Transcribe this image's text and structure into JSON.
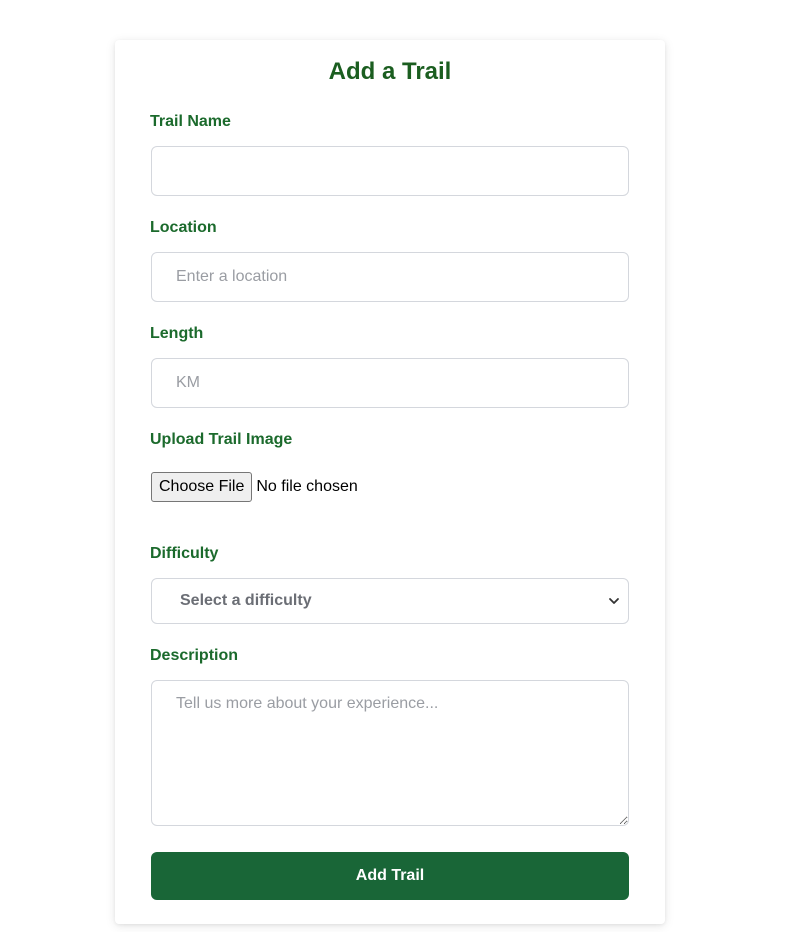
{
  "form": {
    "title": "Add a Trail",
    "trail_name": {
      "label": "Trail Name",
      "value": "",
      "placeholder": ""
    },
    "location": {
      "label": "Location",
      "value": "",
      "placeholder": "Enter a location"
    },
    "length": {
      "label": "Length",
      "value": "",
      "placeholder": "KM"
    },
    "image": {
      "label": "Upload Trail Image",
      "button_label": "Choose File",
      "status": "No file chosen"
    },
    "difficulty": {
      "label": "Difficulty",
      "selected": "Select a difficulty",
      "icon": "chevron-down-icon"
    },
    "description": {
      "label": "Description",
      "value": "",
      "placeholder": "Tell us more about your experience..."
    },
    "submit_label": "Add Trail"
  },
  "colors": {
    "accent": "#196637",
    "label": "#1b6a2c",
    "title": "#1b5e20",
    "border": "#d4d7dd",
    "placeholder": "#9a9da3"
  }
}
